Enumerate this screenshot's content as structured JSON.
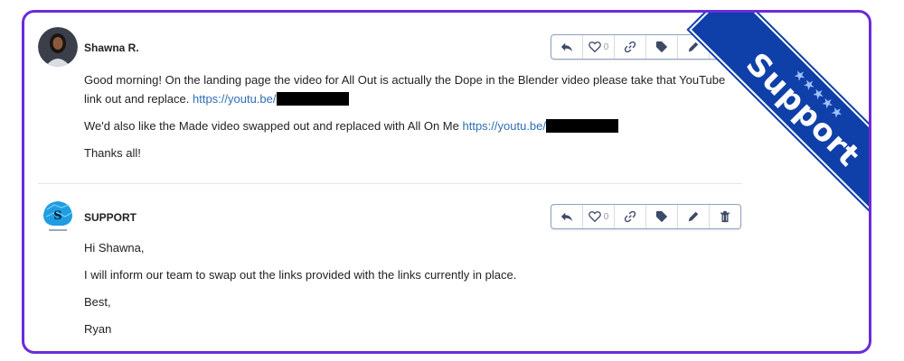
{
  "posts": [
    {
      "author": "Shawna R.",
      "likes": "0",
      "paragraphs": {
        "p1_text": "Good morning! On the landing page the video for All Out is actually the Dope in the Blender video please take that YouTube link out and replace.",
        "p1_link": "https://youtu.be/",
        "p2_text": "We'd also like the Made video swapped out and replaced with All On Me",
        "p2_link": "https://youtu.be/",
        "p3_text": "Thanks all!"
      }
    },
    {
      "author": "SUPPORT",
      "likes": "0",
      "paragraphs": {
        "p1_text": "Hi Shawna,",
        "p2_text": "I will inform our team to swap out the links provided with the links currently in place.",
        "p3_text": "Best,",
        "p4_text": "Ryan"
      }
    }
  ],
  "ribbon": {
    "label": "Support",
    "stars": "★★★★★"
  },
  "colors": {
    "frame": "#6b2bd9",
    "ribbon": "#0f3fa8",
    "link": "#2f6eb5"
  },
  "icons": [
    "reply-icon",
    "heart-icon",
    "link-icon",
    "tag-icon",
    "pencil-icon",
    "trash-icon"
  ]
}
